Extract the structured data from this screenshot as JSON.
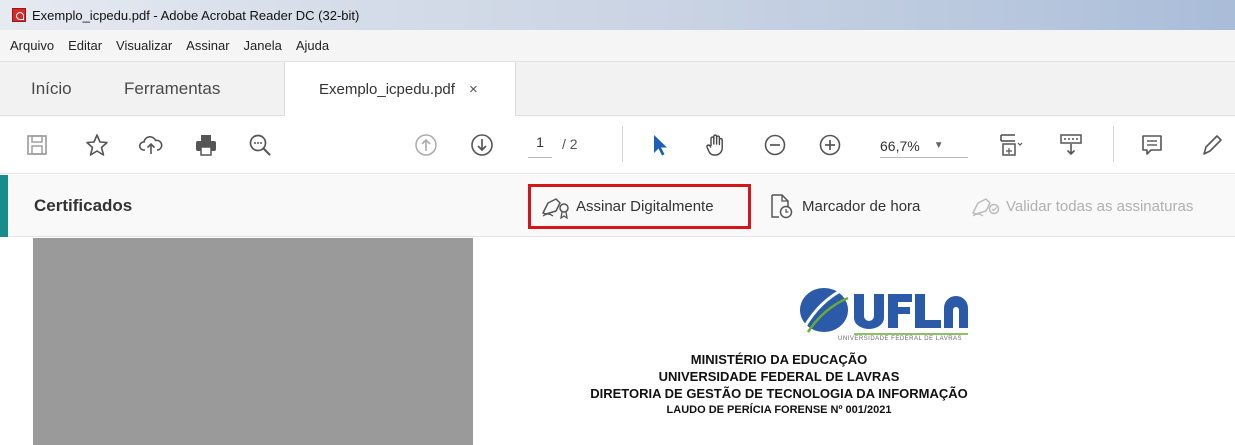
{
  "window": {
    "title": "Exemplo_icpedu.pdf - Adobe Acrobat Reader DC (32-bit)"
  },
  "menu": [
    "Arquivo",
    "Editar",
    "Visualizar",
    "Assinar",
    "Janela",
    "Ajuda"
  ],
  "tabs": {
    "home": "Início",
    "tools": "Ferramentas",
    "document": "Exemplo_icpedu.pdf",
    "close": "×"
  },
  "toolbar": {
    "page_current": "1",
    "page_total": "/ 2",
    "zoom": "66,7%",
    "zoom_caret": "▼"
  },
  "certificates": {
    "title": "Certificados",
    "sign_digitally": "Assinar Digitalmente",
    "timestamp": "Marcador de hora",
    "validate_all": "Validar todas as assinaturas"
  },
  "document": {
    "logo_caption": "UNIVERSIDADE FEDERAL DE LAVRAS",
    "line1": "MINISTÉRIO DA EDUCAÇÃO",
    "line2": "UNIVERSIDADE FEDERAL DE LAVRAS",
    "line3": "DIRETORIA DE GESTÃO DE TECNOLOGIA DA INFORMAÇÃO",
    "line4": "LAUDO DE PERÍCIA FORENSE Nº 001/2021"
  },
  "colors": {
    "accent": "#1a8b8d",
    "highlight": "#d4161b",
    "select_arrow": "#1d5fb8",
    "logo_blue": "#2a5aa8",
    "logo_green": "#6aab35"
  }
}
